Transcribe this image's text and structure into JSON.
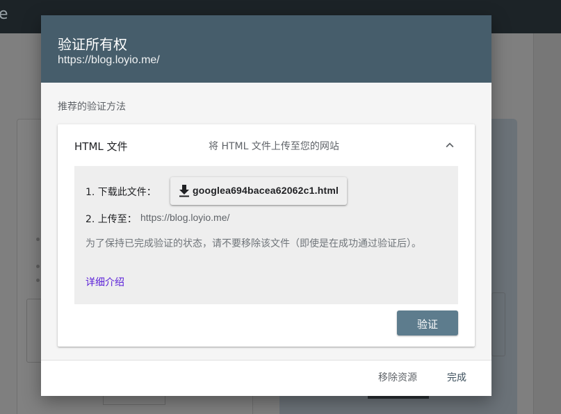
{
  "background": {
    "app_letter": "e"
  },
  "dialog": {
    "title": "验证所有权",
    "subtitle": "https://blog.loyio.me/",
    "section_label": "推荐的验证方法",
    "method": {
      "name": "HTML 文件",
      "description": "将 HTML 文件上传至您的网站",
      "expanded": true,
      "step1_label": "1. 下载此文件：",
      "download_filename": "googlea694bacea62062c1.html",
      "step2_label": "2. 上传至：",
      "upload_url": "https://blog.loyio.me/",
      "keep_note": "为了保持已完成验证的状态，请不要移除该文件（即使是在成功通过验证后）。",
      "details_link": "详细介绍",
      "verify_label": "验证"
    },
    "footer": {
      "remove_label": "移除资源",
      "done_label": "完成"
    }
  },
  "colors": {
    "header": "#465d6b",
    "verify_button": "#5d7c8d",
    "link": "#5a1fd8"
  },
  "icons": {
    "collapse": "chevron-up-icon",
    "download": "download-icon"
  }
}
